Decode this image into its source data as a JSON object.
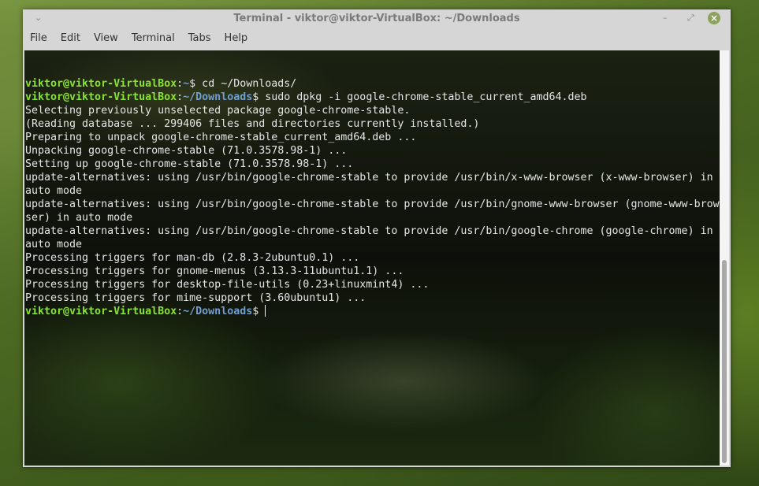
{
  "window": {
    "title": "Terminal - viktor@viktor-VirtualBox: ~/Downloads"
  },
  "menu": [
    "File",
    "Edit",
    "View",
    "Terminal",
    "Tabs",
    "Help"
  ],
  "terminal": {
    "scroll_position_fraction": 1.0,
    "lines": [
      {
        "user": "viktor@viktor-VirtualBox",
        "sep": ":",
        "path": "~",
        "cmd": "$ cd ~/Downloads/"
      },
      {
        "user": "viktor@viktor-VirtualBox",
        "sep": ":",
        "path": "~/Downloads",
        "cmd": "$ sudo dpkg -i google-chrome-stable_current_amd64.deb"
      },
      {
        "text": "Selecting previously unselected package google-chrome-stable."
      },
      {
        "text": "(Reading database ... 299406 files and directories currently installed.)"
      },
      {
        "text": "Preparing to unpack google-chrome-stable_current_amd64.deb ..."
      },
      {
        "text": "Unpacking google-chrome-stable (71.0.3578.98-1) ..."
      },
      {
        "text": "Setting up google-chrome-stable (71.0.3578.98-1) ..."
      },
      {
        "text": "update-alternatives: using /usr/bin/google-chrome-stable to provide /usr/bin/x-www-browser (x-www-browser) in"
      },
      {
        "text": "auto mode"
      },
      {
        "text": "update-alternatives: using /usr/bin/google-chrome-stable to provide /usr/bin/gnome-www-browser (gnome-www-brow"
      },
      {
        "text": "ser) in auto mode"
      },
      {
        "text": "update-alternatives: using /usr/bin/google-chrome-stable to provide /usr/bin/google-chrome (google-chrome) in"
      },
      {
        "text": "auto mode"
      },
      {
        "text": "Processing triggers for man-db (2.8.3-2ubuntu0.1) ..."
      },
      {
        "text": "Processing triggers for gnome-menus (3.13.3-11ubuntu1.1) ..."
      },
      {
        "text": "Processing triggers for desktop-file-utils (0.23+linuxmint4) ..."
      },
      {
        "text": "Processing triggers for mime-support (3.60ubuntu1) ..."
      },
      {
        "user": "viktor@viktor-VirtualBox",
        "sep": ":",
        "path": "~/Downloads",
        "cmd": "$ ",
        "cursor": true
      }
    ]
  }
}
